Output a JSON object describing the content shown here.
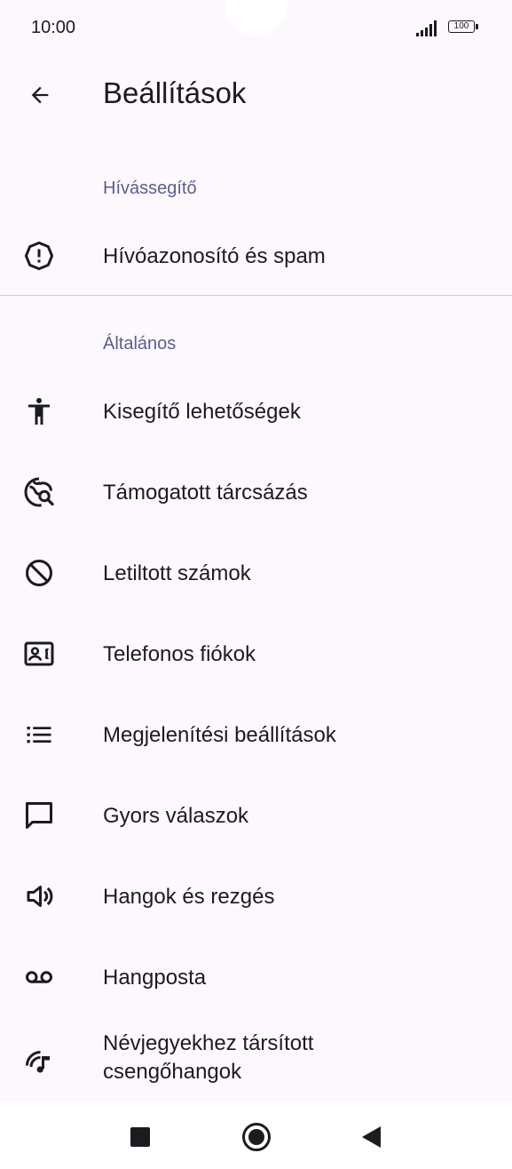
{
  "status": {
    "time": "10:00",
    "battery": "100"
  },
  "header": {
    "title": "Beállítások"
  },
  "sections": [
    {
      "title": "Hívássegítő"
    },
    {
      "title": "Általános"
    }
  ],
  "items": [
    {
      "label": "Hívóazonosító és spam",
      "icon": "alert-icon"
    },
    {
      "label": "Kisegítő lehetőségek",
      "icon": "accessibility-icon"
    },
    {
      "label": "Támogatott tárcsázás",
      "icon": "assisted-dialing-icon"
    },
    {
      "label": "Letiltott számok",
      "icon": "block-icon"
    },
    {
      "label": "Telefonos fiókok",
      "icon": "contact-card-icon"
    },
    {
      "label": "Megjelenítési beállítások",
      "icon": "list-icon"
    },
    {
      "label": "Gyors válaszok",
      "icon": "message-icon"
    },
    {
      "label": "Hangok és rezgés",
      "icon": "volume-icon"
    },
    {
      "label": "Hangposta",
      "icon": "voicemail-icon"
    },
    {
      "label_line1": "Névjegyekhez társított",
      "label_line2": "csengőhangok",
      "icon": "ringtone-icon"
    }
  ],
  "colors": {
    "accent_text": "#5b5d8f",
    "background": "#fdf8fd"
  }
}
